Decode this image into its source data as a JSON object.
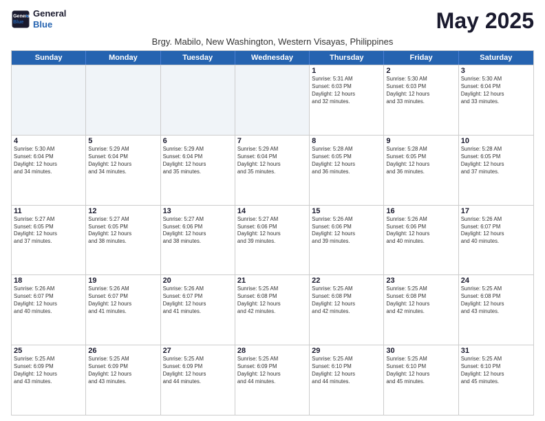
{
  "logo": {
    "line1": "General",
    "line2": "Blue"
  },
  "title": "May 2025",
  "subtitle": "Brgy. Mabilo, New Washington, Western Visayas, Philippines",
  "header_days": [
    "Sunday",
    "Monday",
    "Tuesday",
    "Wednesday",
    "Thursday",
    "Friday",
    "Saturday"
  ],
  "weeks": [
    [
      {
        "day": "",
        "info": ""
      },
      {
        "day": "",
        "info": ""
      },
      {
        "day": "",
        "info": ""
      },
      {
        "day": "",
        "info": ""
      },
      {
        "day": "1",
        "info": "Sunrise: 5:31 AM\nSunset: 6:03 PM\nDaylight: 12 hours\nand 32 minutes."
      },
      {
        "day": "2",
        "info": "Sunrise: 5:30 AM\nSunset: 6:03 PM\nDaylight: 12 hours\nand 33 minutes."
      },
      {
        "day": "3",
        "info": "Sunrise: 5:30 AM\nSunset: 6:04 PM\nDaylight: 12 hours\nand 33 minutes."
      }
    ],
    [
      {
        "day": "4",
        "info": "Sunrise: 5:30 AM\nSunset: 6:04 PM\nDaylight: 12 hours\nand 34 minutes."
      },
      {
        "day": "5",
        "info": "Sunrise: 5:29 AM\nSunset: 6:04 PM\nDaylight: 12 hours\nand 34 minutes."
      },
      {
        "day": "6",
        "info": "Sunrise: 5:29 AM\nSunset: 6:04 PM\nDaylight: 12 hours\nand 35 minutes."
      },
      {
        "day": "7",
        "info": "Sunrise: 5:29 AM\nSunset: 6:04 PM\nDaylight: 12 hours\nand 35 minutes."
      },
      {
        "day": "8",
        "info": "Sunrise: 5:28 AM\nSunset: 6:05 PM\nDaylight: 12 hours\nand 36 minutes."
      },
      {
        "day": "9",
        "info": "Sunrise: 5:28 AM\nSunset: 6:05 PM\nDaylight: 12 hours\nand 36 minutes."
      },
      {
        "day": "10",
        "info": "Sunrise: 5:28 AM\nSunset: 6:05 PM\nDaylight: 12 hours\nand 37 minutes."
      }
    ],
    [
      {
        "day": "11",
        "info": "Sunrise: 5:27 AM\nSunset: 6:05 PM\nDaylight: 12 hours\nand 37 minutes."
      },
      {
        "day": "12",
        "info": "Sunrise: 5:27 AM\nSunset: 6:05 PM\nDaylight: 12 hours\nand 38 minutes."
      },
      {
        "day": "13",
        "info": "Sunrise: 5:27 AM\nSunset: 6:06 PM\nDaylight: 12 hours\nand 38 minutes."
      },
      {
        "day": "14",
        "info": "Sunrise: 5:27 AM\nSunset: 6:06 PM\nDaylight: 12 hours\nand 39 minutes."
      },
      {
        "day": "15",
        "info": "Sunrise: 5:26 AM\nSunset: 6:06 PM\nDaylight: 12 hours\nand 39 minutes."
      },
      {
        "day": "16",
        "info": "Sunrise: 5:26 AM\nSunset: 6:06 PM\nDaylight: 12 hours\nand 40 minutes."
      },
      {
        "day": "17",
        "info": "Sunrise: 5:26 AM\nSunset: 6:07 PM\nDaylight: 12 hours\nand 40 minutes."
      }
    ],
    [
      {
        "day": "18",
        "info": "Sunrise: 5:26 AM\nSunset: 6:07 PM\nDaylight: 12 hours\nand 40 minutes."
      },
      {
        "day": "19",
        "info": "Sunrise: 5:26 AM\nSunset: 6:07 PM\nDaylight: 12 hours\nand 41 minutes."
      },
      {
        "day": "20",
        "info": "Sunrise: 5:26 AM\nSunset: 6:07 PM\nDaylight: 12 hours\nand 41 minutes."
      },
      {
        "day": "21",
        "info": "Sunrise: 5:25 AM\nSunset: 6:08 PM\nDaylight: 12 hours\nand 42 minutes."
      },
      {
        "day": "22",
        "info": "Sunrise: 5:25 AM\nSunset: 6:08 PM\nDaylight: 12 hours\nand 42 minutes."
      },
      {
        "day": "23",
        "info": "Sunrise: 5:25 AM\nSunset: 6:08 PM\nDaylight: 12 hours\nand 42 minutes."
      },
      {
        "day": "24",
        "info": "Sunrise: 5:25 AM\nSunset: 6:08 PM\nDaylight: 12 hours\nand 43 minutes."
      }
    ],
    [
      {
        "day": "25",
        "info": "Sunrise: 5:25 AM\nSunset: 6:09 PM\nDaylight: 12 hours\nand 43 minutes."
      },
      {
        "day": "26",
        "info": "Sunrise: 5:25 AM\nSunset: 6:09 PM\nDaylight: 12 hours\nand 43 minutes."
      },
      {
        "day": "27",
        "info": "Sunrise: 5:25 AM\nSunset: 6:09 PM\nDaylight: 12 hours\nand 44 minutes."
      },
      {
        "day": "28",
        "info": "Sunrise: 5:25 AM\nSunset: 6:09 PM\nDaylight: 12 hours\nand 44 minutes."
      },
      {
        "day": "29",
        "info": "Sunrise: 5:25 AM\nSunset: 6:10 PM\nDaylight: 12 hours\nand 44 minutes."
      },
      {
        "day": "30",
        "info": "Sunrise: 5:25 AM\nSunset: 6:10 PM\nDaylight: 12 hours\nand 45 minutes."
      },
      {
        "day": "31",
        "info": "Sunrise: 5:25 AM\nSunset: 6:10 PM\nDaylight: 12 hours\nand 45 minutes."
      }
    ]
  ]
}
